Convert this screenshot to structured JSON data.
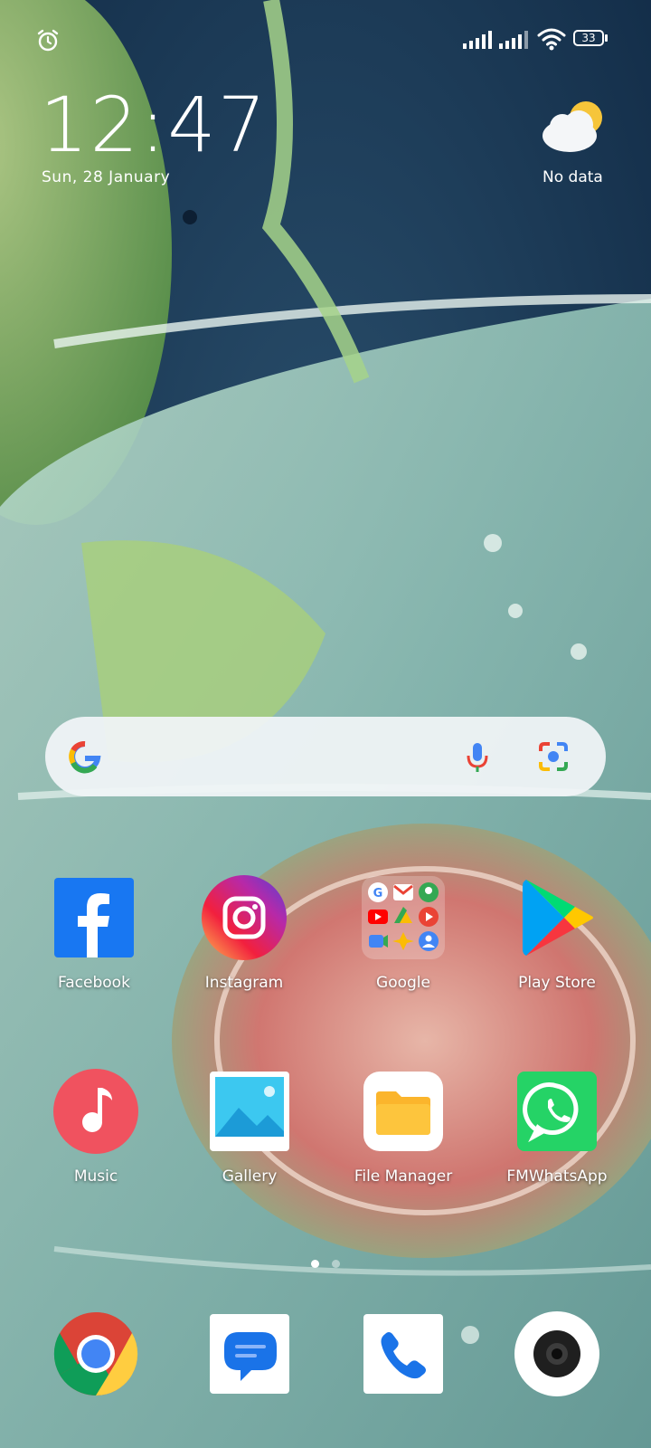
{
  "status": {
    "battery": "33"
  },
  "lockscreen": {
    "time": "12:47",
    "date": "Sun, 28 January",
    "weather": "No data"
  },
  "search": {
    "g_icon": "google-g-icon",
    "mic_icon": "mic-icon",
    "lens_icon": "lens-icon"
  },
  "apps": [
    {
      "label": "Facebook"
    },
    {
      "label": "Instagram"
    },
    {
      "label": "Google"
    },
    {
      "label": "Play Store"
    },
    {
      "label": "Music"
    },
    {
      "label": "Gallery"
    },
    {
      "label": "File Manager"
    },
    {
      "label": "FMWhatsApp"
    }
  ],
  "dock": [
    {
      "icon": "chrome-icon"
    },
    {
      "icon": "messages-icon"
    },
    {
      "icon": "phone-icon"
    },
    {
      "icon": "camera-icon"
    }
  ],
  "pages": {
    "count": 2,
    "active": 0
  },
  "colors": {
    "facebook": "#1877F2",
    "music": "#F0525F",
    "whatsapp": "#25D366",
    "files": "#FBB52C"
  }
}
